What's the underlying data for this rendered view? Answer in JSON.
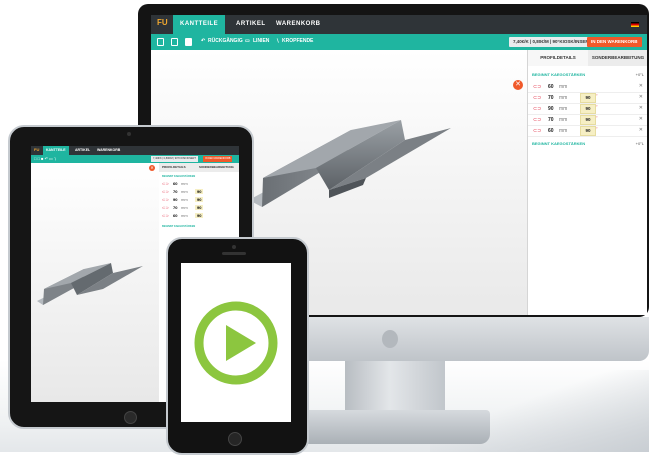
{
  "app": {
    "logo": "FU",
    "nav": [
      "KANTTEILE",
      "ARTIKEL",
      "WARENKORB"
    ],
    "toolbar": {
      "undo_label": "RÜCKGÄNGIG",
      "line_label": "LINIEN",
      "edge_label": "KROPFENDE",
      "price_button": "7,40€/K | 0,80€/M | 90°KIOSK/INSERT",
      "cart_button": "IN DEN WARENKORB"
    },
    "panel": {
      "tabs": [
        "PROFILDETAILS",
        "SONDERBEARBEITUNG"
      ],
      "section_start": "BEGINNT KAEGOSTÄRKEN",
      "section_end": "BEGINNT KAEGOSTÄRKEN",
      "section_value": "+0°L",
      "rows": [
        {
          "value": "60",
          "unit": "mm",
          "angle": ""
        },
        {
          "value": "70",
          "unit": "mm",
          "angle": "90"
        },
        {
          "value": "90",
          "unit": "mm",
          "angle": "90"
        },
        {
          "value": "70",
          "unit": "mm",
          "angle": "90"
        },
        {
          "value": "60",
          "unit": "mm",
          "angle": "90"
        }
      ]
    }
  },
  "colors": {
    "teal": "#1fb5a0",
    "dark": "#2f3438",
    "orange": "#f0592a",
    "play_green": "#8cc63f"
  },
  "icons": [
    "new-file-icon",
    "open-folder-icon",
    "save-icon",
    "undo-icon",
    "line-icon",
    "edge-icon",
    "cart-icon",
    "lock-icon",
    "close-icon",
    "play-icon"
  ]
}
